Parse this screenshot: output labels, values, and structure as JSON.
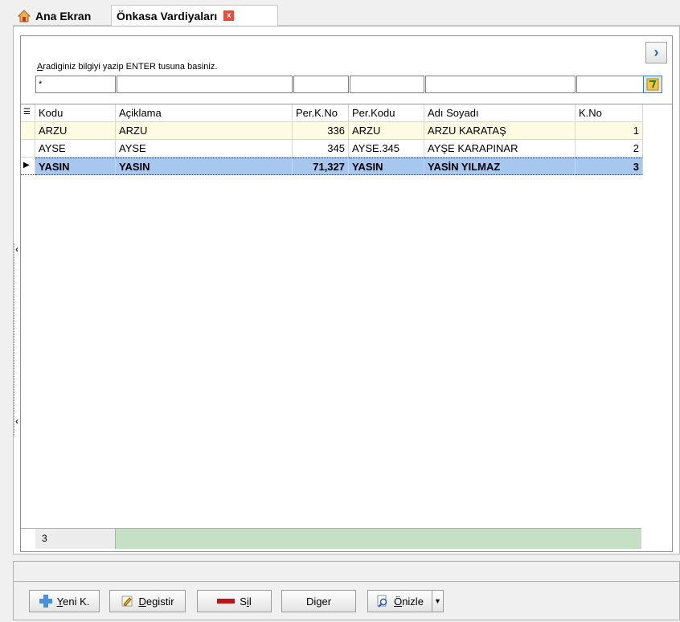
{
  "tabs": [
    {
      "label": "Ana Ekran"
    },
    {
      "label": "Önkasa Vardiyaları",
      "close": "x"
    }
  ],
  "search": {
    "hint_prefix": "A",
    "hint_rest": "radiginiz bilgiyi yazip ENTER tusuna basiniz.",
    "filter_first_value": "*",
    "next_symbol": "›"
  },
  "grid": {
    "columns": [
      "Kodu",
      "Açiklama",
      "Per.K.No",
      "Per.Kodu",
      "Adı Soyadı",
      "K.No"
    ],
    "rows": [
      [
        "ARZU",
        "ARZU",
        "336",
        "ARZU",
        "ARZU KARATAŞ",
        "1"
      ],
      [
        "AYSE",
        "AYSE",
        "345",
        "AYSE.345",
        "AYŞE KARAPINAR",
        "2"
      ],
      [
        "YASIN",
        "YASIN",
        "71,327",
        "YASIN",
        "YASİN YILMAZ",
        "3"
      ]
    ],
    "selected_row_index": 2,
    "selected_marker": "▶",
    "record_count": "3"
  },
  "buttons": {
    "new": {
      "u": "Y",
      "rest": "eni K."
    },
    "edit": {
      "u": "D",
      "rest": "egistir"
    },
    "delete": {
      "pre": "S",
      "u": "i",
      "rest": "l"
    },
    "other": {
      "pre": "Di",
      "u": "g",
      "rest": "er"
    },
    "preview": {
      "u": "Ö",
      "rest": "nizle",
      "arrow": "▼"
    }
  },
  "colors": {
    "selected_row": "#a7c7ee",
    "first_row": "#fdfbe1",
    "summary_bar": "#c6e0c6",
    "close_badge": "#e74c3c"
  }
}
